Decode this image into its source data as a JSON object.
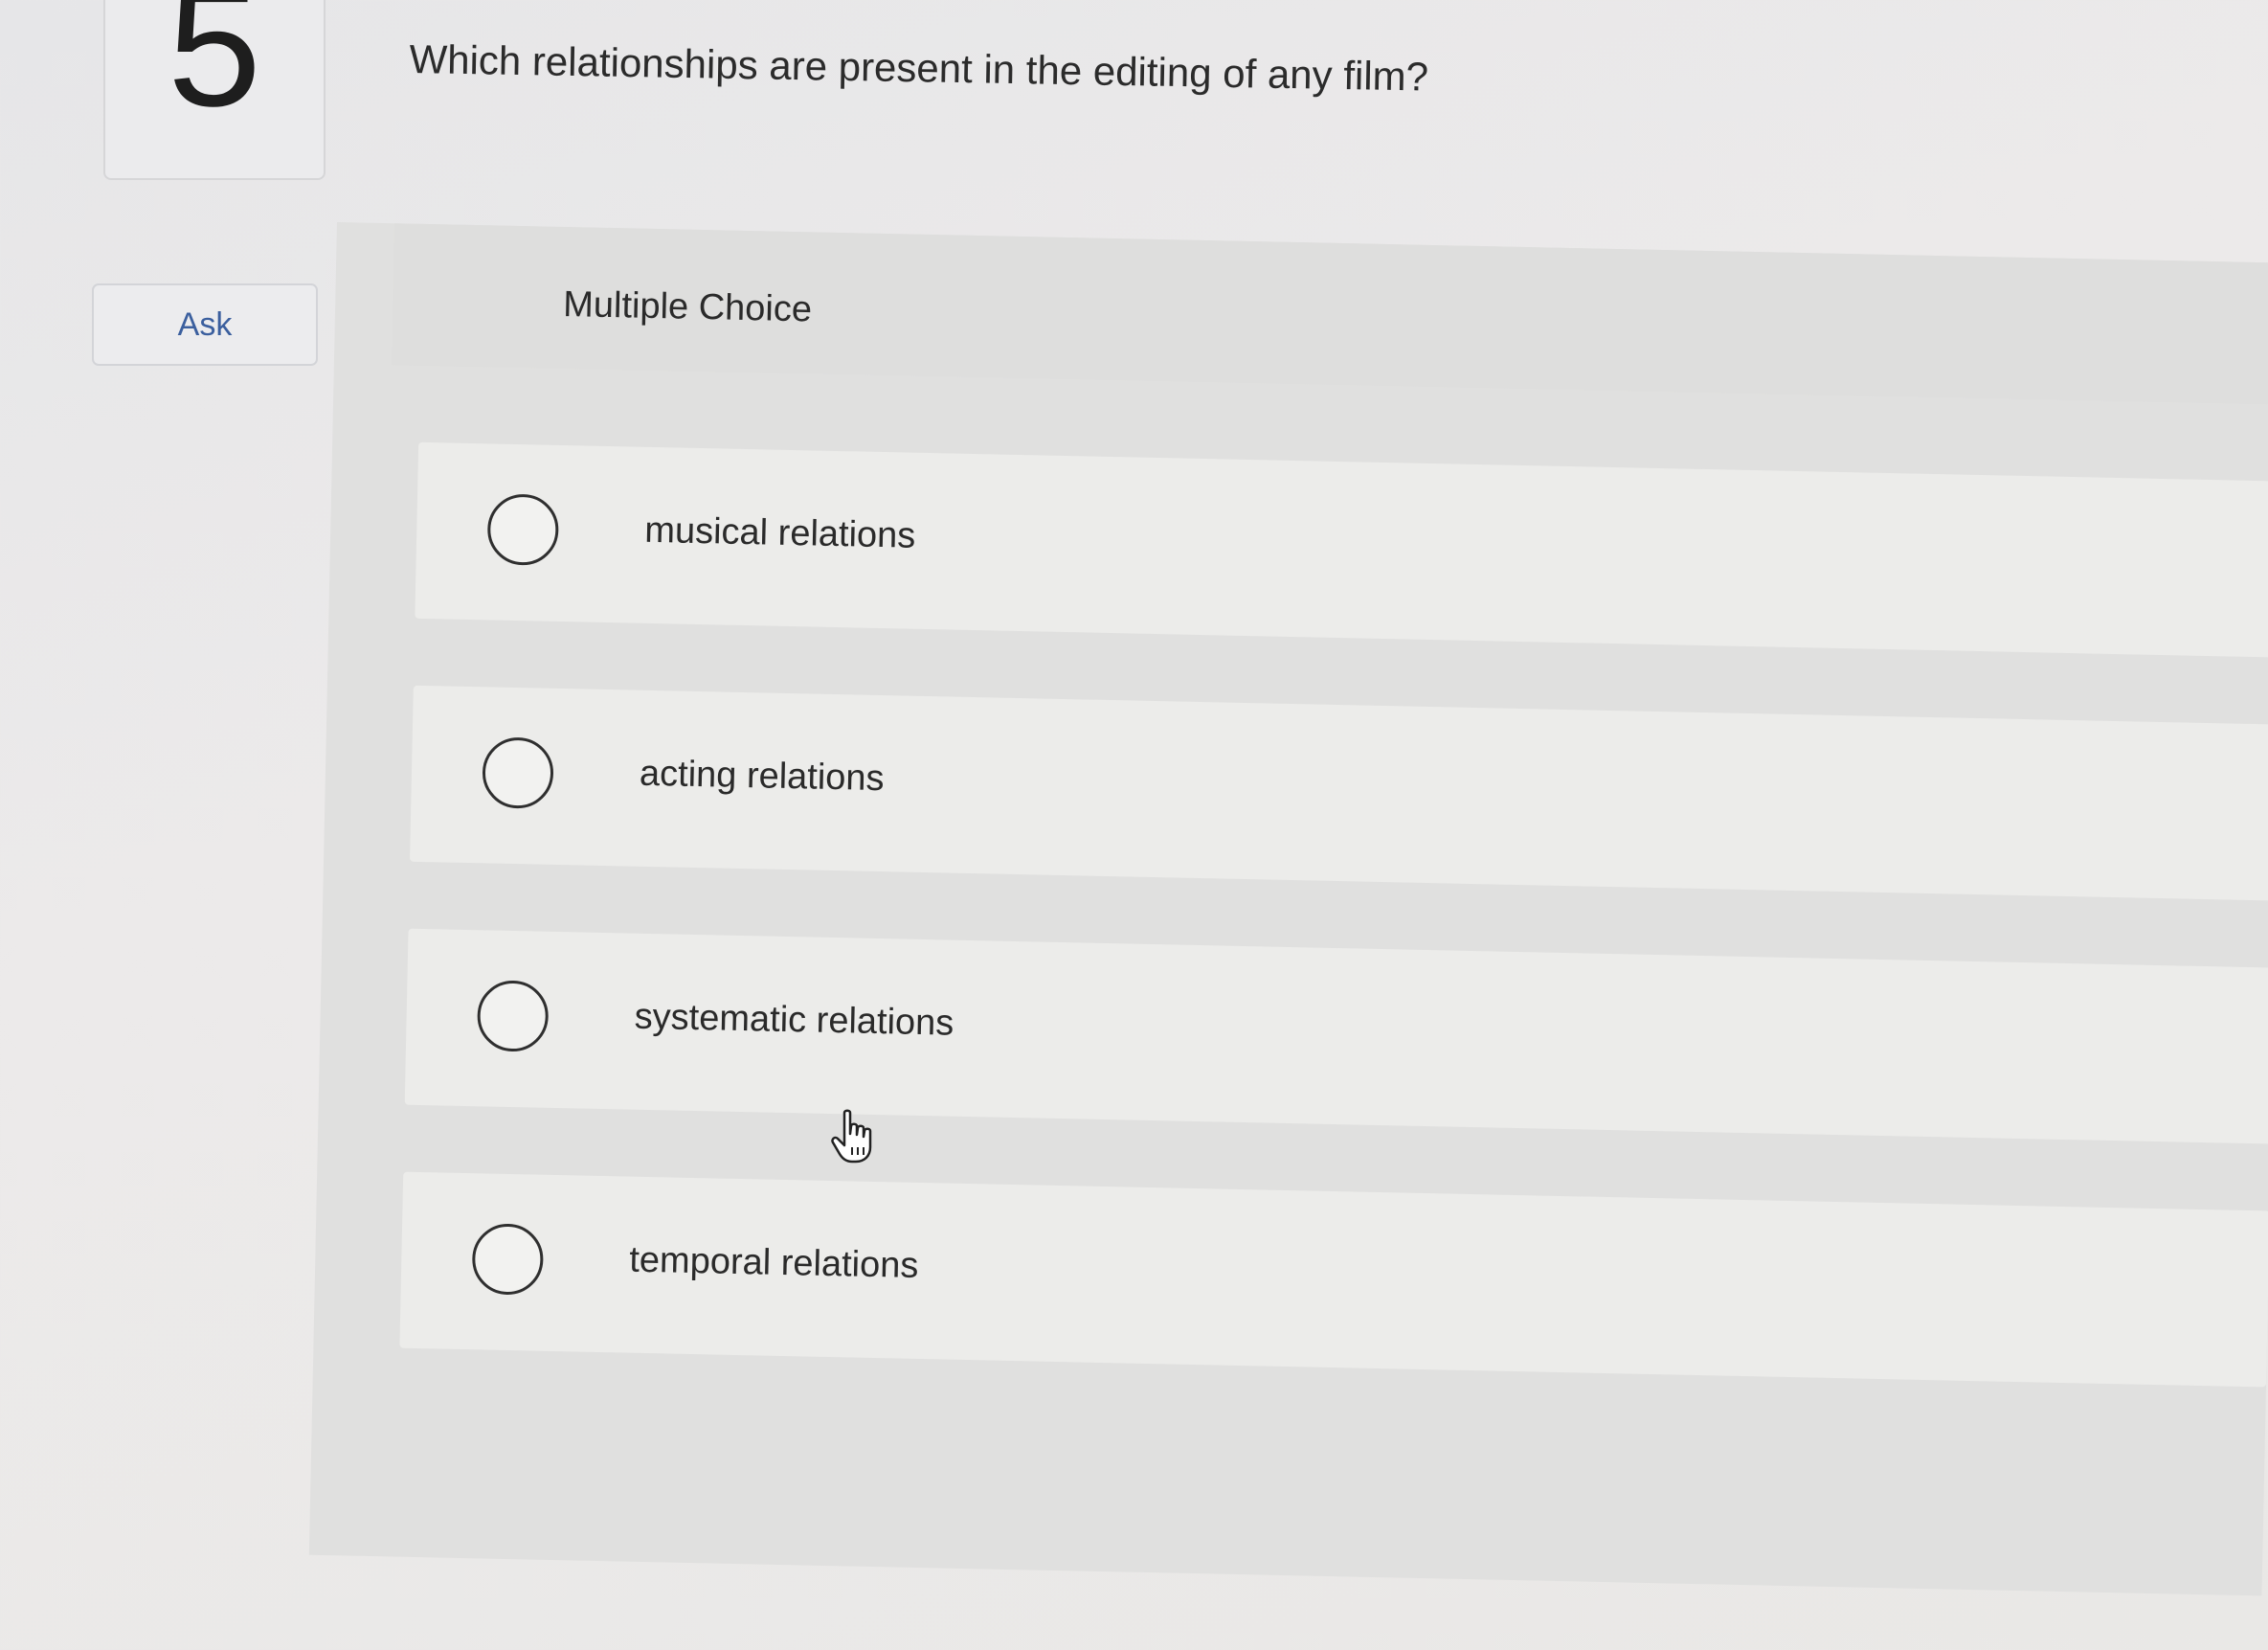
{
  "question_number": "5",
  "ask_button": "Ask",
  "question_text": "Which relationships are present in the editing of any film?",
  "question_type": "Multiple Choice",
  "options": [
    {
      "label": "musical relations"
    },
    {
      "label": "acting relations"
    },
    {
      "label": "systematic relations"
    },
    {
      "label": "temporal relations"
    }
  ],
  "colors": {
    "background": "#e9e8e6",
    "panel": "#e0e0df",
    "option_card": "#ececea",
    "ask_text": "#3b5f9e",
    "radio_border": "#2f2f2f"
  },
  "icons": {
    "cursor": "hand-pointer-icon",
    "radio": "radio-unselected-icon"
  }
}
